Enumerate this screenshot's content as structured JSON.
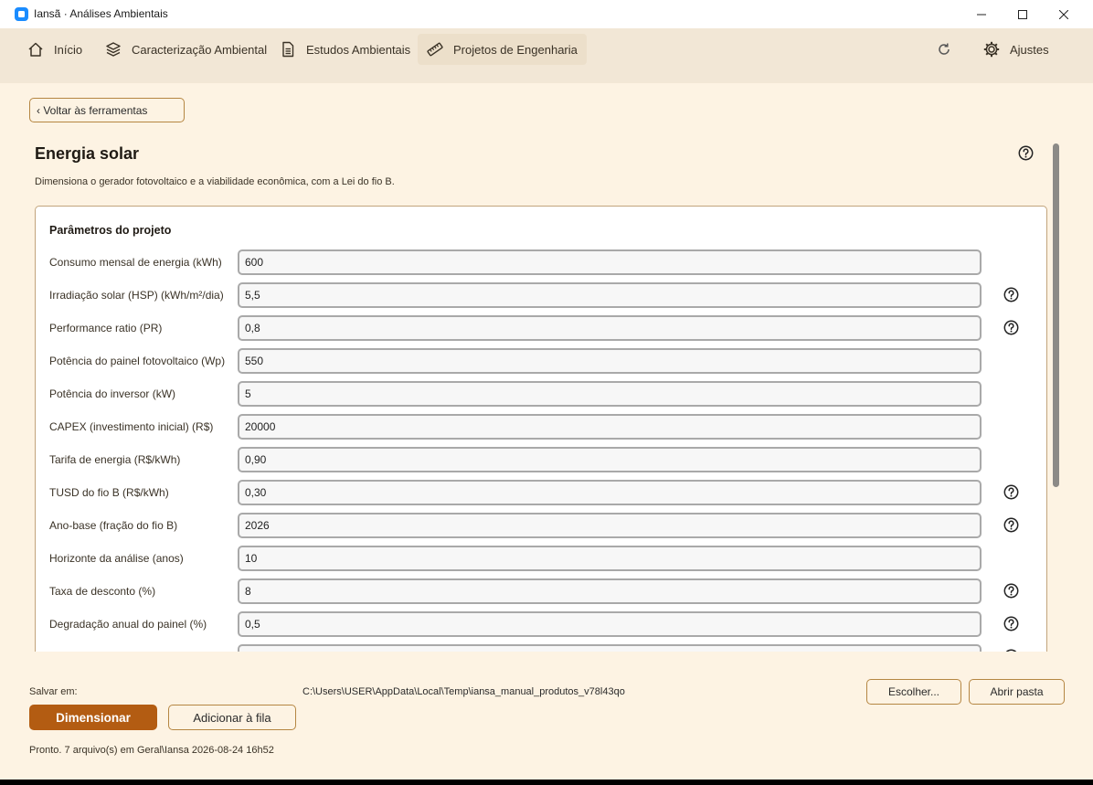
{
  "window": {
    "title": "Iansã · Análises Ambientais"
  },
  "nav": {
    "items": [
      {
        "label": "Início",
        "icon": "home-icon"
      },
      {
        "label": "Caracterização Ambiental",
        "icon": "layers-icon"
      },
      {
        "label": "Estudos Ambientais",
        "icon": "document-icon"
      },
      {
        "label": "Projetos de Engenharia",
        "icon": "ruler-icon",
        "active": true
      }
    ],
    "settings_label": "Ajustes",
    "refresh_icon": "refresh-icon",
    "settings_icon": "gear-icon"
  },
  "back_button": "‹ Voltar às ferramentas",
  "page": {
    "title": "Energia solar",
    "subtitle": "Dimensiona o gerador fotovoltaico e a viabilidade econômica, com a Lei do fio B."
  },
  "params": {
    "title": "Parâmetros do projeto",
    "rows": [
      {
        "label": "Consumo mensal de energia (kWh)",
        "value": "600",
        "help": false
      },
      {
        "label": "Irradiação solar (HSP) (kWh/m²/dia)",
        "value": "5,5",
        "help": true
      },
      {
        "label": "Performance ratio (PR)",
        "value": "0,8",
        "help": true
      },
      {
        "label": "Potência do painel fotovoltaico (Wp)",
        "value": "550",
        "help": false
      },
      {
        "label": "Potência do inversor (kW)",
        "value": "5",
        "help": false
      },
      {
        "label": "CAPEX (investimento inicial) (R$)",
        "value": "20000",
        "help": false
      },
      {
        "label": "Tarifa de energia (R$/kWh)",
        "value": "0,90",
        "help": false
      },
      {
        "label": "TUSD do fio B (R$/kWh)",
        "value": "0,30",
        "help": true
      },
      {
        "label": "Ano-base (fração do fio B)",
        "value": "2026",
        "help": true
      },
      {
        "label": "Horizonte da análise (anos)",
        "value": "10",
        "help": false
      },
      {
        "label": "Taxa de desconto (%)",
        "value": "8",
        "help": true
      },
      {
        "label": "Degradação anual do painel (%)",
        "value": "0,5",
        "help": true
      }
    ]
  },
  "save": {
    "label": "Salvar em:",
    "path": "C:\\Users\\USER\\AppData\\Local\\Temp\\iansa_manual_produtos_v78l43qo",
    "choose_button": "Escolher...",
    "open_button": "Abrir pasta"
  },
  "actions": {
    "primary": "Dimensionar",
    "queue": "Adicionar à fila"
  },
  "status": "Pronto. 7 arquivo(s) em Geral\\Iansa 2026-08-24 16h52",
  "colors": {
    "accent": "#b35c12",
    "border_accent": "#b58642",
    "background": "#fdf3e3",
    "navbar": "#f2e7d6"
  }
}
